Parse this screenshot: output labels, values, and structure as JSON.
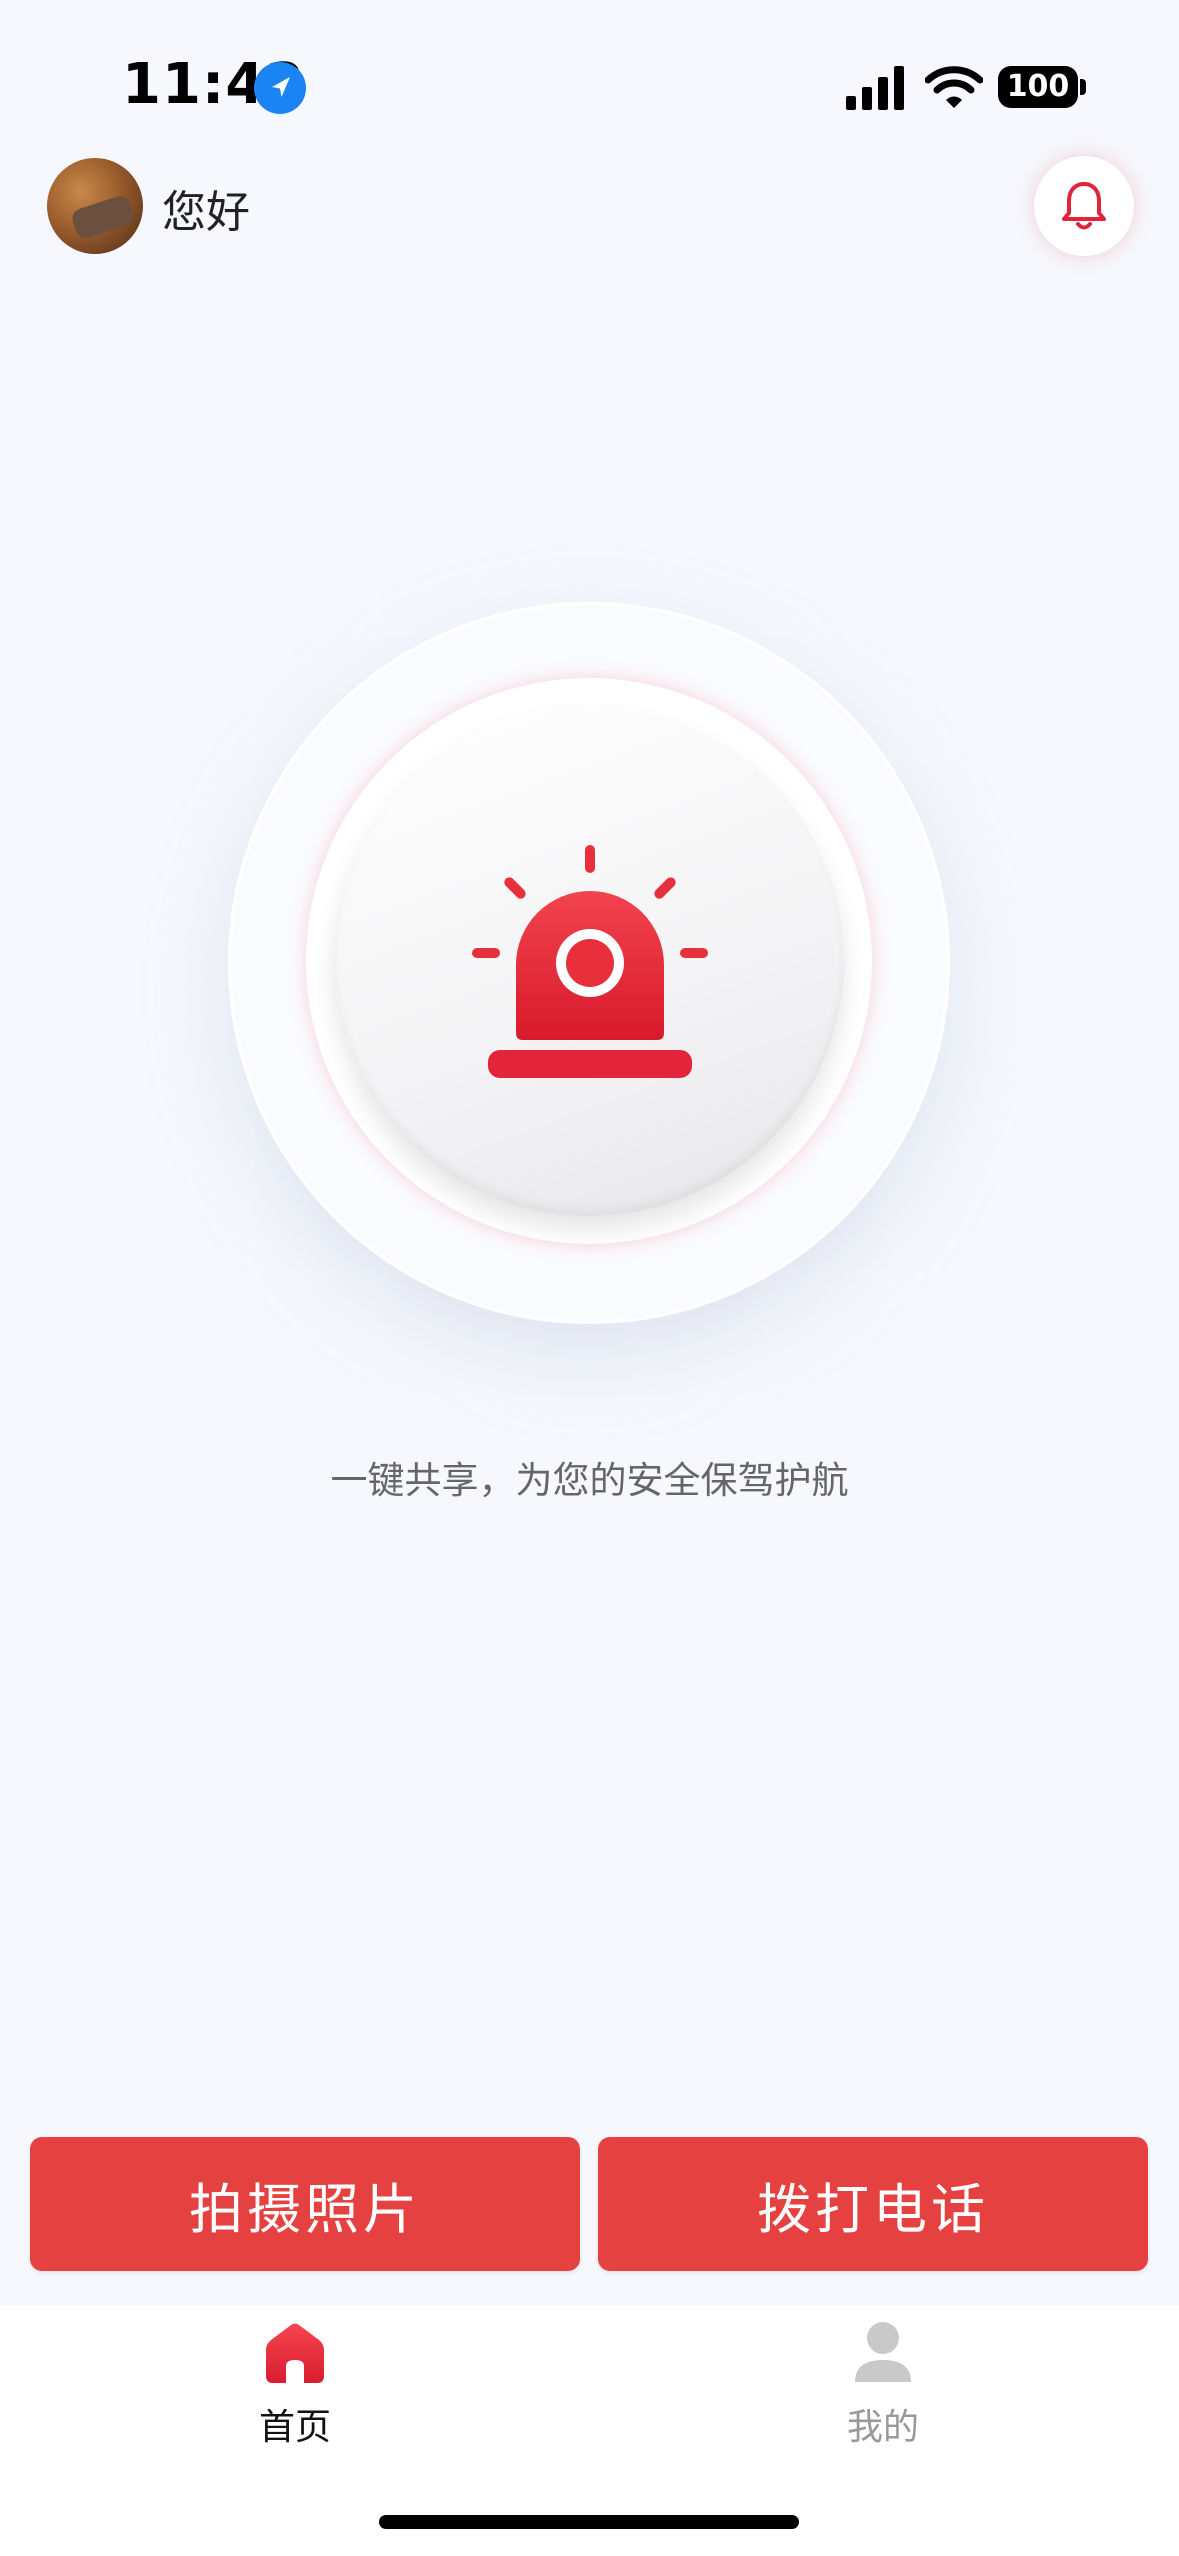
{
  "status_bar": {
    "time": "11:42",
    "battery": "100"
  },
  "header": {
    "greeting": "您好",
    "avatar_icon": "user-avatar",
    "bell_icon": "bell-icon"
  },
  "main": {
    "alarm_icon": "siren-icon",
    "slogan": "一键共享，为您的安全保驾护航"
  },
  "actions": {
    "photo_label": "拍摄照片",
    "call_label": "拨打电话"
  },
  "tabs": [
    {
      "label": "首页",
      "icon": "home-icon",
      "active": true
    },
    {
      "label": "我的",
      "icon": "person-icon",
      "active": false
    }
  ],
  "colors": {
    "accent": "#e64141",
    "background": "#f6f8fd",
    "inactive": "#999999"
  }
}
